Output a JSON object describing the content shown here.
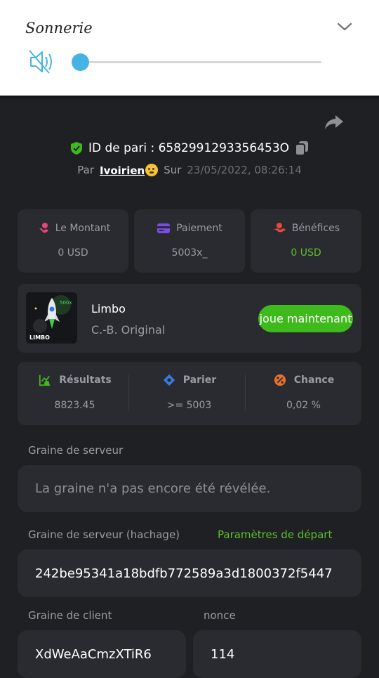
{
  "ringtone": {
    "title": "Sonnerie",
    "volume_level": 0,
    "icons": {
      "mute": "speaker-muted-icon",
      "expand": "chevron-down-icon"
    }
  },
  "bet": {
    "id_text": "ID de pari : 6582991293356453O",
    "by_label": "Par",
    "username": "Ivoirien",
    "on_label": "Sur",
    "date": "23/05/2022, 08:26:14"
  },
  "stats": [
    {
      "label": "Le Montant",
      "value": "0 USD",
      "icon": "money-hand-icon",
      "color": "#e8457c"
    },
    {
      "label": "Paiement",
      "value": "5003x_",
      "icon": "card-icon",
      "color": "#7b4ce8"
    },
    {
      "label": "Bénéfices",
      "value": "0 USD",
      "icon": "profit-hand-icon",
      "color": "#e5483e",
      "value_color": "#5fbf2b"
    }
  ],
  "game": {
    "name": "Limbo",
    "provider": "C.-B. Original",
    "play_label": "joue maintenant",
    "thumb_text": "LIMBO",
    "thumb_multiplier": "500x"
  },
  "results": [
    {
      "label": "Résultats",
      "value": "8823.45",
      "icon": "chart-check-icon",
      "color": "#3fba1c"
    },
    {
      "label": "Parier",
      "value": ">= 5003",
      "icon": "target-tag-icon",
      "color": "#3a7be0"
    },
    {
      "label": "Chance",
      "value": "0,02 %",
      "icon": "percent-icon",
      "color": "#e8702a"
    }
  ],
  "seeds": {
    "server_seed_label": "Graine de serveur",
    "server_seed_placeholder": "La graine n'a pas encore été révélée.",
    "server_hash_label": "Graine de serveur (hachage)",
    "start_params_link": "Paramètres de départ",
    "server_hash_value": "242be95341a18bdfb772589a3d1800372f5447",
    "client_seed_label": "Graine de client",
    "client_seed_value": "XdWeAaCmzXTiR6",
    "nonce_label": "nonce",
    "nonce_value": "114"
  },
  "colors": {
    "accent_green": "#3fba1c",
    "slider_blue": "#47b3e5",
    "background": "#1f2024",
    "card": "#2a2b30"
  }
}
